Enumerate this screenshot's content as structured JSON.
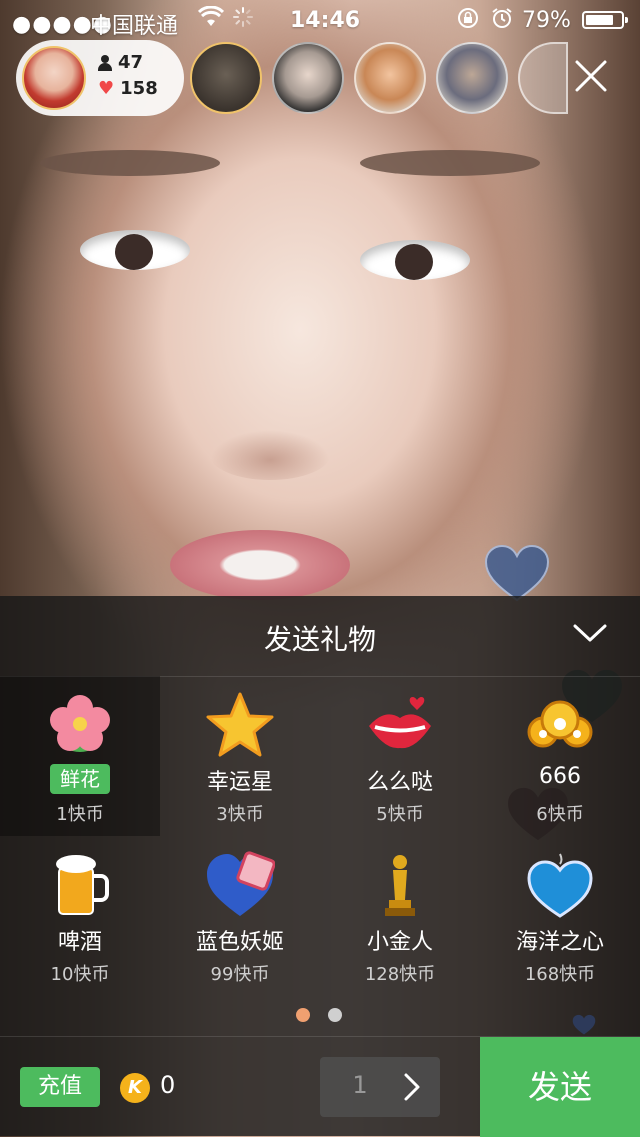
{
  "status_bar": {
    "signal": "●●●●●",
    "carrier": "中国联通",
    "time": "14:46",
    "battery": "79%",
    "battery_level": 0.79
  },
  "host": {
    "viewers": "47",
    "likes": "158"
  },
  "viewers_count_shown": 5,
  "gift_panel": {
    "title": "发送礼物",
    "gifts": [
      {
        "name": "鲜花",
        "price": "1快币",
        "icon": "flower-icon",
        "selected": true
      },
      {
        "name": "幸运星",
        "price": "3快币",
        "icon": "star-icon",
        "selected": false
      },
      {
        "name": "么么哒",
        "price": "5快币",
        "icon": "kiss-icon",
        "selected": false
      },
      {
        "name": "666",
        "price": "6快币",
        "icon": "666-icon",
        "selected": false
      },
      {
        "name": "啤酒",
        "price": "10快币",
        "icon": "beer-icon",
        "selected": false
      },
      {
        "name": "蓝色妖姬",
        "price": "99快币",
        "icon": "blue-rose-box-icon",
        "selected": false
      },
      {
        "name": "小金人",
        "price": "128快币",
        "icon": "oscar-statue-icon",
        "selected": false
      },
      {
        "name": "海洋之心",
        "price": "168快币",
        "icon": "heart-of-ocean-icon",
        "selected": false
      }
    ],
    "page_index": 0,
    "page_count": 2
  },
  "bottom_bar": {
    "recharge_label": "充值",
    "coin_symbol": "K",
    "balance": "0",
    "quantity": "1",
    "send_label": "发送"
  },
  "colors": {
    "accent_green": "#4dbb5e",
    "coin_gold": "#f5b21b",
    "dot_active": "#f0a070",
    "dot_inactive": "#cfcfcf"
  }
}
